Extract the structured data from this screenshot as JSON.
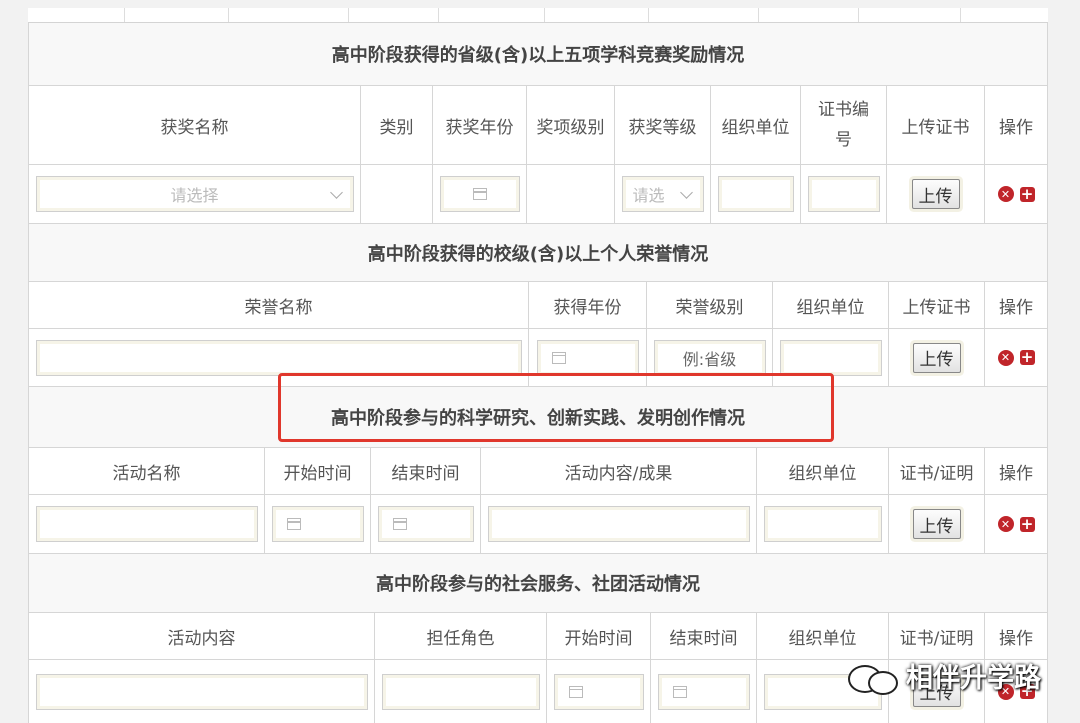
{
  "sections": {
    "competitions": {
      "title": "高中阶段获得的省级(含)以上五项学科竞赛奖励情况",
      "headers": [
        "获奖名称",
        "类别",
        "获奖年份",
        "奖项级别",
        "获奖等级",
        "组织单位",
        "证书编号",
        "上传证书",
        "操作"
      ],
      "award_name_placeholder": "请选择",
      "grade_placeholder": "请选"
    },
    "honors": {
      "title": "高中阶段获得的校级(含)以上个人荣誉情况",
      "headers": [
        "荣誉名称",
        "获得年份",
        "荣誉级别",
        "组织单位",
        "上传证书",
        "操作"
      ],
      "level_placeholder": "例:省级"
    },
    "research": {
      "title": "高中阶段参与的科学研究、创新实践、发明创作情况",
      "headers": [
        "活动名称",
        "开始时间",
        "结束时间",
        "活动内容/成果",
        "组织单位",
        "证书/证明",
        "操作"
      ]
    },
    "service": {
      "title": "高中阶段参与的社会服务、社团活动情况",
      "headers": [
        "活动内容",
        "担任角色",
        "开始时间",
        "结束时间",
        "组织单位",
        "证书/证明",
        "操作"
      ]
    }
  },
  "upload_label": "上传",
  "icons": {
    "delete": "close-circle-icon",
    "add": "plus-square-icon",
    "date": "calendar-icon"
  },
  "colors": {
    "highlight": "#e0372c",
    "action_red": "#c0252a"
  },
  "watermark": "相伴升学路"
}
